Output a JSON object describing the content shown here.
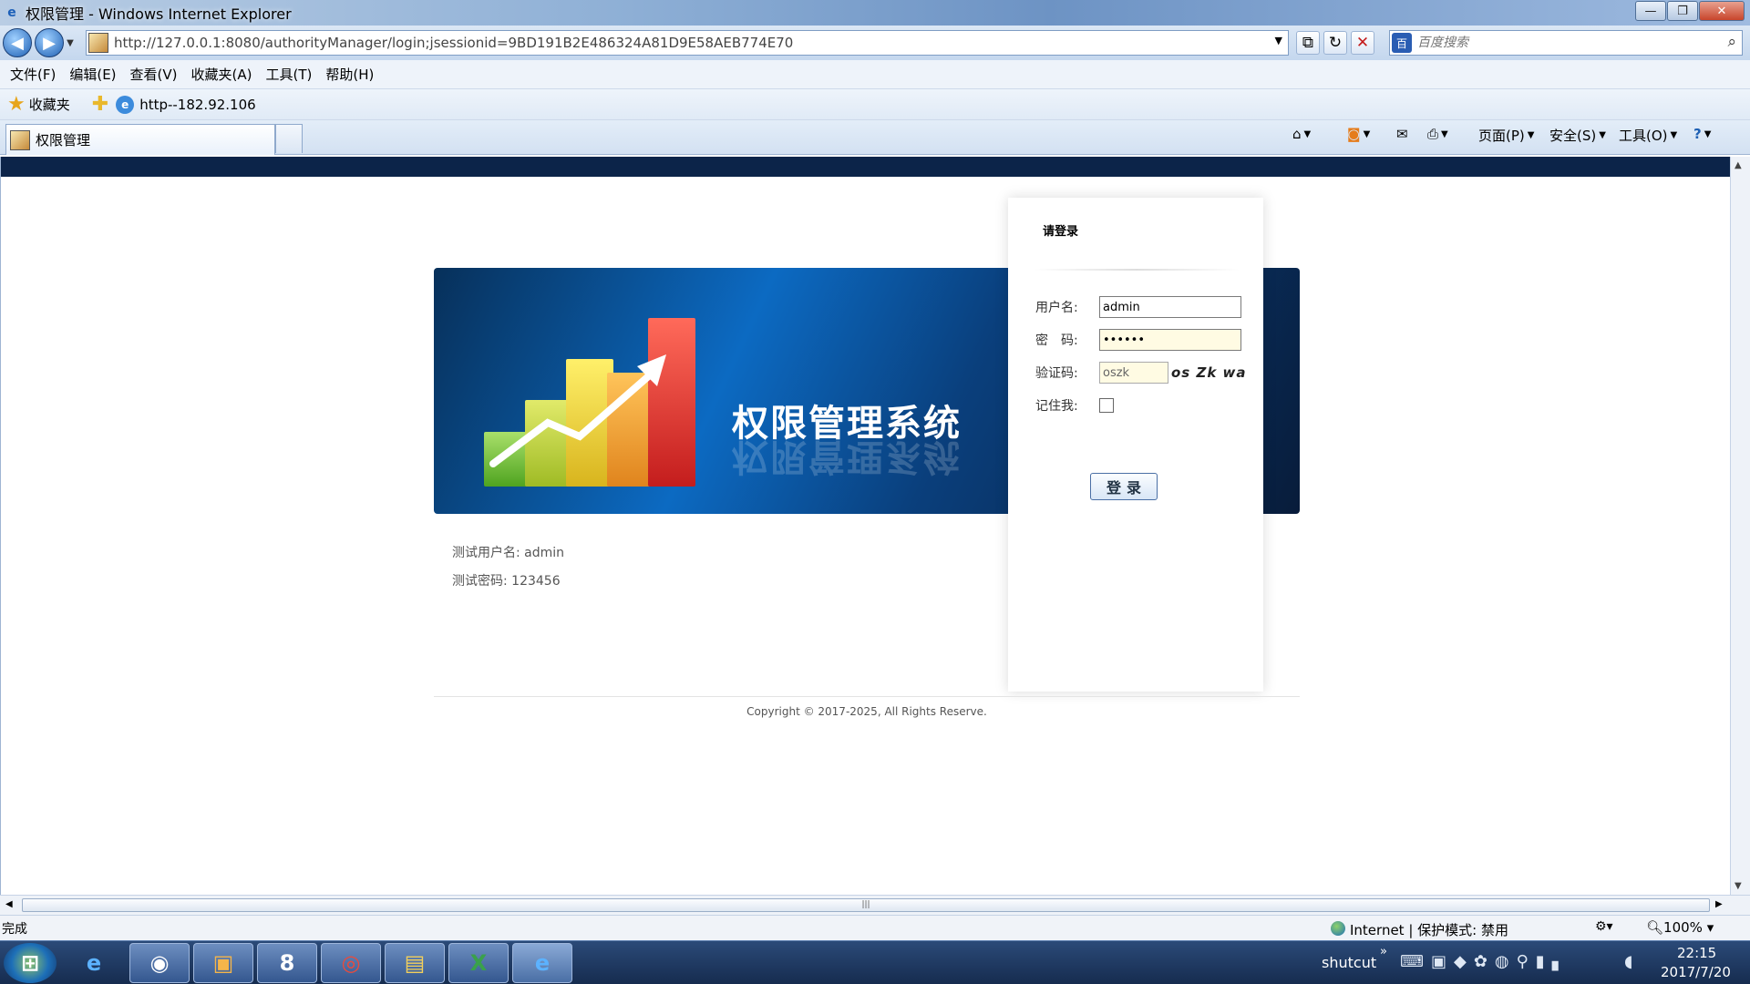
{
  "window": {
    "title": "权限管理 - Windows Internet Explorer",
    "controls": {
      "minimize": "—",
      "restore": "❐",
      "close": "✕"
    }
  },
  "navigation": {
    "back_icon": "back-arrow-icon",
    "forward_icon": "forward-arrow-icon",
    "address": "http://127.0.0.1:8080/authorityManager/login;jsessionid=9BD191B2E486324A81D9E58AEB774E70",
    "search_placeholder": "百度搜索"
  },
  "menu": [
    "文件(F)",
    "编辑(E)",
    "查看(V)",
    "收藏夹(A)",
    "工具(T)",
    "帮助(H)"
  ],
  "favorites": {
    "label": "收藏夹",
    "link": "http--182.92.106"
  },
  "tab": {
    "label": "权限管理"
  },
  "command_bar": {
    "page": "页面(P)",
    "safety": "安全(S)",
    "tools": "工具(O)"
  },
  "banner": {
    "title": "权限管理系统"
  },
  "login": {
    "heading": "请登录",
    "username_label": "用户名:",
    "username_value": "admin",
    "password_label": "密　码:",
    "password_value": "123456",
    "captcha_label": "验证码:",
    "captcha_value": "oszk",
    "captcha_image_text": "os Zk wa",
    "remember_label": "记住我:",
    "submit_label": "登录"
  },
  "hints": {
    "user": "测试用户名: admin",
    "password": "测试密码: 123456"
  },
  "footer": {
    "copyright": "Copyright © 2017-2025, All Rights Reserve."
  },
  "status": {
    "left": "完成",
    "zone": "Internet | 保护模式: 禁用",
    "zoom": "100%"
  },
  "taskbar": {
    "tray_label": "shutcut",
    "time": "22:15",
    "date": "2017/7/20"
  },
  "colors": {
    "banner_dark": "#0c2449",
    "accent": "#1d5fb3"
  }
}
